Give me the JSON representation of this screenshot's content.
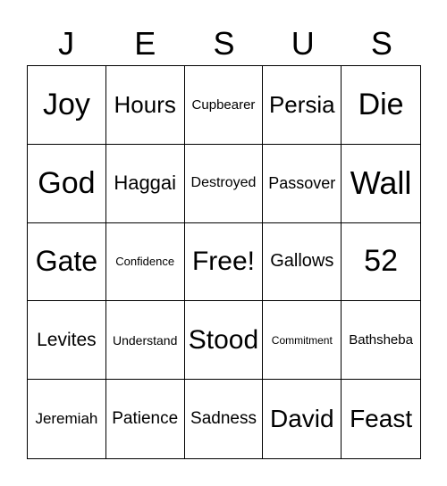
{
  "header": [
    "J",
    "E",
    "S",
    "U",
    "S"
  ],
  "cells": [
    {
      "text": "Joy",
      "size": 34
    },
    {
      "text": "Hours",
      "size": 26
    },
    {
      "text": "Cupbearer",
      "size": 15
    },
    {
      "text": "Persia",
      "size": 26
    },
    {
      "text": "Die",
      "size": 34
    },
    {
      "text": "God",
      "size": 34
    },
    {
      "text": "Haggai",
      "size": 22
    },
    {
      "text": "Destroyed",
      "size": 16
    },
    {
      "text": "Passover",
      "size": 18
    },
    {
      "text": "Wall",
      "size": 36
    },
    {
      "text": "Gate",
      "size": 32
    },
    {
      "text": "Confidence",
      "size": 13
    },
    {
      "text": "Free!",
      "size": 30
    },
    {
      "text": "Gallows",
      "size": 20
    },
    {
      "text": "52",
      "size": 34
    },
    {
      "text": "Levites",
      "size": 21
    },
    {
      "text": "Understand",
      "size": 14
    },
    {
      "text": "Stood",
      "size": 30
    },
    {
      "text": "Commitment",
      "size": 12
    },
    {
      "text": "Bathsheba",
      "size": 15
    },
    {
      "text": "Jeremiah",
      "size": 17
    },
    {
      "text": "Patience",
      "size": 19
    },
    {
      "text": "Sadness",
      "size": 19
    },
    {
      "text": "David",
      "size": 28
    },
    {
      "text": "Feast",
      "size": 28
    }
  ]
}
